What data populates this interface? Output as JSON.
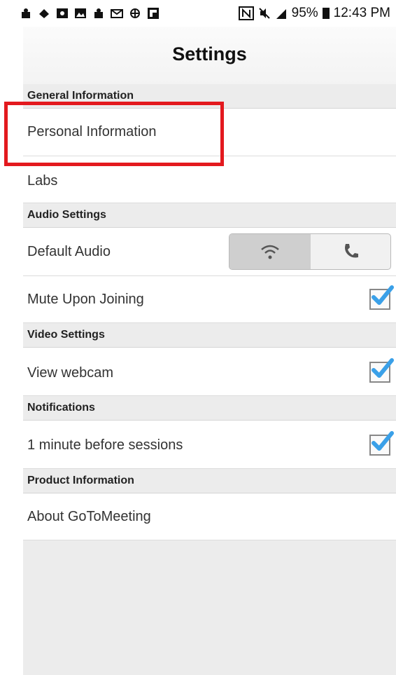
{
  "status_bar": {
    "battery": "95%",
    "time": "12:43 PM",
    "left_icons": [
      "notification-icon",
      "notification-icon",
      "photo-icon",
      "photo-icon",
      "notification-icon",
      "mail-icon",
      "notification-icon",
      "flipboard-icon"
    ],
    "right_icons": [
      "nfc-icon",
      "mute-icon",
      "signal-icon",
      "battery-icon"
    ]
  },
  "header": {
    "title": "Settings"
  },
  "sections": {
    "general": "General Information",
    "audio": "Audio Settings",
    "video": "Video Settings",
    "notifications": "Notifications",
    "product": "Product Information"
  },
  "rows": {
    "personal": "Personal Information",
    "labs": "Labs",
    "default_audio": "Default Audio",
    "mute_upon_joining": "Mute Upon Joining",
    "view_webcam": "View webcam",
    "minute_before": "1 minute before sessions",
    "about": "About GoToMeeting"
  },
  "default_audio_options": [
    "wifi-icon",
    "phone-icon"
  ],
  "default_audio_selected": "wifi-icon",
  "checkboxes": {
    "mute_upon_joining": true,
    "view_webcam": true,
    "minute_before": true
  },
  "colors": {
    "highlight": "#e3191e",
    "check": "#3aa0e8"
  }
}
